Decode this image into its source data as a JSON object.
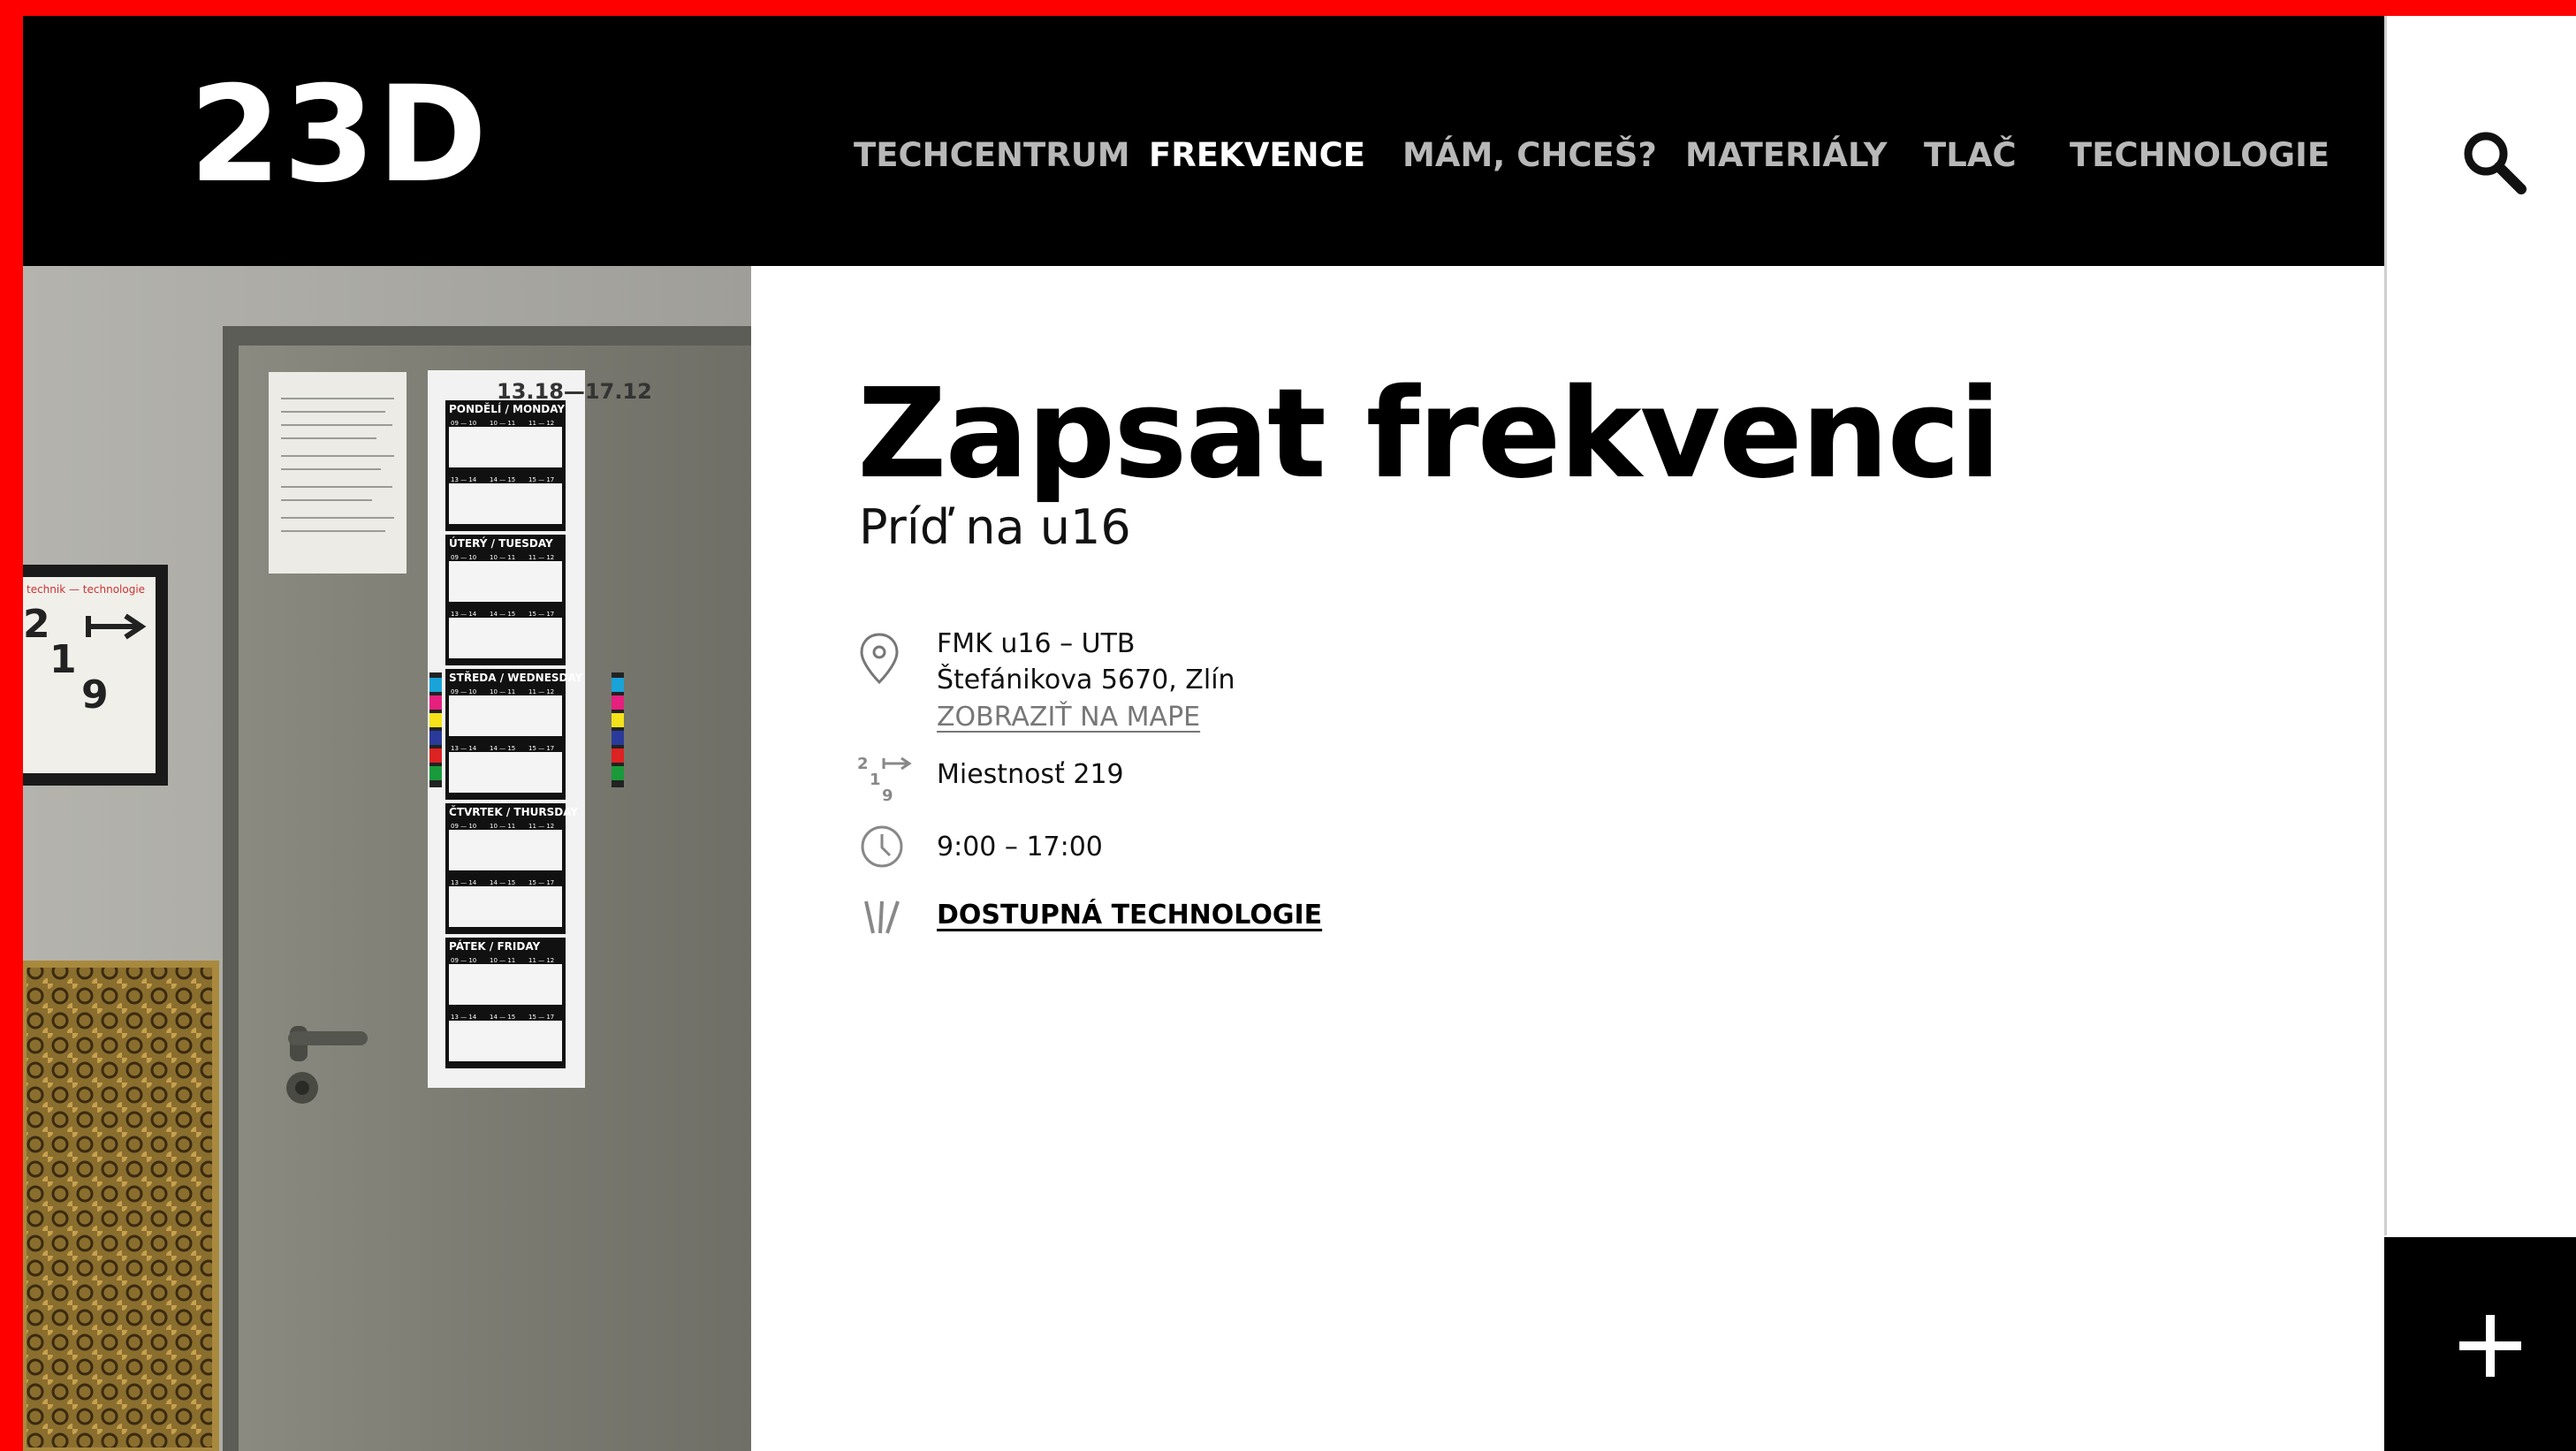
{
  "brand": {
    "logo": "23D",
    "accent": "#ff0000"
  },
  "nav": {
    "items": [
      {
        "label": "TECHCENTRUM",
        "active": false
      },
      {
        "label": "FREKVENCE",
        "active": true
      },
      {
        "label": "MÁM, CHCEŠ?",
        "active": false
      },
      {
        "label": "MATERIÁLY",
        "active": false
      },
      {
        "label": "TLAČ",
        "active": false
      },
      {
        "label": "TECHNOLOGIE",
        "active": false
      }
    ]
  },
  "icons": {
    "search": "search-icon",
    "plus": "plus-icon",
    "location": "location-pin-icon",
    "room": "room-number-icon",
    "clock": "clock-icon",
    "tech": "technology-lines-icon"
  },
  "main": {
    "title": "Zapsat frekvenci",
    "subtitle": "Príď na u16",
    "address_line1": "FMK u16 – UTB",
    "address_line2": "Štefánikova 5670, Zlín",
    "map_link": "ZOBRAZIŤ NA MAPE",
    "room": "Miestnosť 219",
    "hours": "9:00 – 17:00",
    "tech_link": "DOSTUPNÁ TECHNOLOGIE"
  },
  "photo": {
    "sign_numbers": [
      "2",
      "1",
      "9"
    ],
    "sign_header": "technik — technologie",
    "poster_dates": "13.18—17.12",
    "poster_days": [
      "PONDĚLÍ / MONDAY",
      "ÚTERÝ / TUESDAY",
      "STŘEDA / WEDNESDAY",
      "ČTVRTEK / THURSDAY",
      "PÁTEK / FRIDAY"
    ],
    "slot_labels": [
      "09 — 10",
      "10 — 11",
      "11 — 12",
      "13 — 14",
      "14 — 15",
      "15 — 17"
    ]
  }
}
